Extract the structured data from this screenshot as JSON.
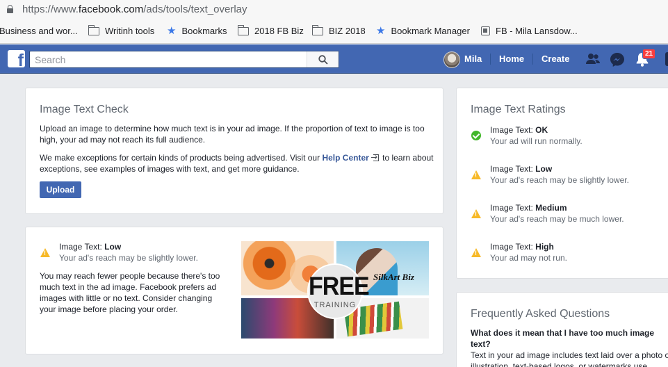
{
  "browser": {
    "url_prefix": "https://www.",
    "url_host": "facebook.com",
    "url_path": "/ads/tools/text_overlay",
    "bookmarks": [
      {
        "label": "Business and wor...",
        "icon": "none"
      },
      {
        "label": "Writinh tools",
        "icon": "folder-icon"
      },
      {
        "label": "Bookmarks",
        "icon": "star-icon"
      },
      {
        "label": "2018 FB Biz",
        "icon": "folder-icon"
      },
      {
        "label": "BIZ 2018",
        "icon": "folder-icon"
      },
      {
        "label": "Bookmark Manager",
        "icon": "star-icon"
      },
      {
        "label": "FB - Mila Lansdow...",
        "icon": "page-icon"
      }
    ]
  },
  "fb_header": {
    "logo": "f",
    "search_placeholder": "Search",
    "user_name": "Mila",
    "nav": [
      "Home",
      "Create"
    ],
    "notification_count": "21",
    "colors": {
      "brand": "#4267b2",
      "badge": "#fa3e3e"
    }
  },
  "check_card": {
    "title": "Image Text Check",
    "para1": "Upload an image to determine how much text is in your ad image. If the proportion of text to image is too high, your ad may not reach its full audience.",
    "para2_before": "We make exceptions for certain kinds of products being advertised. Visit our ",
    "help_link": "Help Center",
    "para2_after": " to learn about exceptions, see examples of images with text, and get more guidance.",
    "upload_label": "Upload"
  },
  "result_card": {
    "rating_prefix": "Image Text: ",
    "rating_value": "Low",
    "rating_desc": "Your ad's reach may be slightly lower.",
    "explanation": "You may reach fewer people because there's too much text in the ad image. Facebook prefers ad images with little or no text. Consider changing your image before placing your order.",
    "image": {
      "headline": "FREE",
      "subline": "TRAINING",
      "brand": "SilkArt Biz"
    }
  },
  "ratings_card": {
    "title": "Image Text Ratings",
    "items": [
      {
        "prefix": "Image Text: ",
        "level": "OK",
        "desc": "Your ad will run normally.",
        "icon": "check-circle-icon"
      },
      {
        "prefix": "Image Text: ",
        "level": "Low",
        "desc": "Your ad's reach may be slightly lower.",
        "icon": "warning-icon"
      },
      {
        "prefix": "Image Text: ",
        "level": "Medium",
        "desc": "Your ad's reach may be much lower.",
        "icon": "warning-icon"
      },
      {
        "prefix": "Image Text: ",
        "level": "High",
        "desc": "Your ad may not run.",
        "icon": "warning-icon"
      }
    ]
  },
  "faq_card": {
    "title": "Frequently Asked Questions",
    "question": "What does it mean that I have too much image text?",
    "answer": "Text in your ad image includes text laid over a photo or illustration, text-based logos, or watermarks use"
  }
}
